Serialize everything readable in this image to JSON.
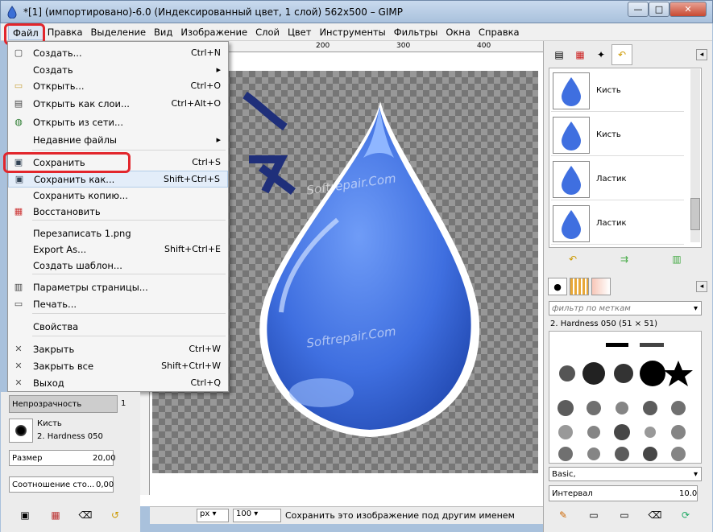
{
  "window": {
    "title": "*[1] (импортировано)-6.0 (Индексированный цвет, 1 слой) 562x500 – GIMP",
    "minimize": "—",
    "maximize": "□",
    "close": "✕"
  },
  "menubar": {
    "items": [
      "Файл",
      "Правка",
      "Выделение",
      "Вид",
      "Изображение",
      "Слой",
      "Цвет",
      "Инструменты",
      "Фильтры",
      "Окна",
      "Справка"
    ]
  },
  "file_menu": {
    "items": [
      {
        "label": "Создать...",
        "shortcut": "Ctrl+N",
        "icon": "new-doc-icon"
      },
      {
        "label": "Создать",
        "shortcut": "▸",
        "icon": ""
      },
      {
        "label": "Открыть...",
        "shortcut": "Ctrl+O",
        "icon": "folder-icon"
      },
      {
        "label": "Открыть как слои...",
        "shortcut": "Ctrl+Alt+O",
        "icon": "layers-open-icon"
      },
      {
        "label": "Открыть из сети...",
        "shortcut": "",
        "icon": "globe-icon"
      },
      {
        "label": "Недавние файлы",
        "shortcut": "▸",
        "icon": ""
      },
      {
        "label": "Сохранить",
        "shortcut": "Ctrl+S",
        "icon": "save-icon"
      },
      {
        "label": "Сохранить как...",
        "shortcut": "Shift+Ctrl+S",
        "icon": "save-as-icon"
      },
      {
        "label": "Сохранить копию...",
        "shortcut": "",
        "icon": ""
      },
      {
        "label": "Восстановить",
        "shortcut": "",
        "icon": "revert-icon"
      },
      {
        "label": "Перезаписать 1.png",
        "shortcut": "",
        "icon": ""
      },
      {
        "label": "Export As...",
        "shortcut": "Shift+Ctrl+E",
        "icon": ""
      },
      {
        "label": "Создать шаблон...",
        "shortcut": "",
        "icon": ""
      },
      {
        "label": "Параметры страницы...",
        "shortcut": "",
        "icon": "page-setup-icon"
      },
      {
        "label": "Печать...",
        "shortcut": "",
        "icon": "print-icon"
      },
      {
        "label": "Свойства",
        "shortcut": "",
        "icon": ""
      },
      {
        "label": "Закрыть",
        "shortcut": "Ctrl+W",
        "icon": "close-x-icon"
      },
      {
        "label": "Закрыть все",
        "shortcut": "Shift+Ctrl+W",
        "icon": "close-all-icon"
      },
      {
        "label": "Выход",
        "shortcut": "Ctrl+Q",
        "icon": "quit-icon"
      }
    ]
  },
  "ruler": {
    "ticks": [
      "200",
      "300",
      "400"
    ]
  },
  "undo_history": {
    "items": [
      {
        "label": "Кисть"
      },
      {
        "label": "Кисть"
      },
      {
        "label": "Ластик"
      },
      {
        "label": "Ластик"
      }
    ]
  },
  "brushes": {
    "filter_placeholder": "фильтр по меткам",
    "current": "2. Hardness 050 (51 × 51)",
    "preset": "Basic,",
    "spacing_label": "Интервал",
    "spacing_value": "10.0"
  },
  "tool_options": {
    "opacity_label": "Непрозрачность",
    "opacity_value": "1",
    "brush_label": "Кисть",
    "brush_value": "2. Hardness 050",
    "size_label": "Размер",
    "size_value": "20,00",
    "aspect_label": "Соотношение сто...",
    "aspect_value": "0,00"
  },
  "statusbar": {
    "unit": "px",
    "zoom": "100",
    "message": "Сохранить это изображение под другим именем"
  },
  "watermark": "Softrepair.Com",
  "colors": {
    "accent_red": "#e2262c",
    "drop_blue": "#3f6fe0",
    "highlight": "#e3edf9"
  }
}
